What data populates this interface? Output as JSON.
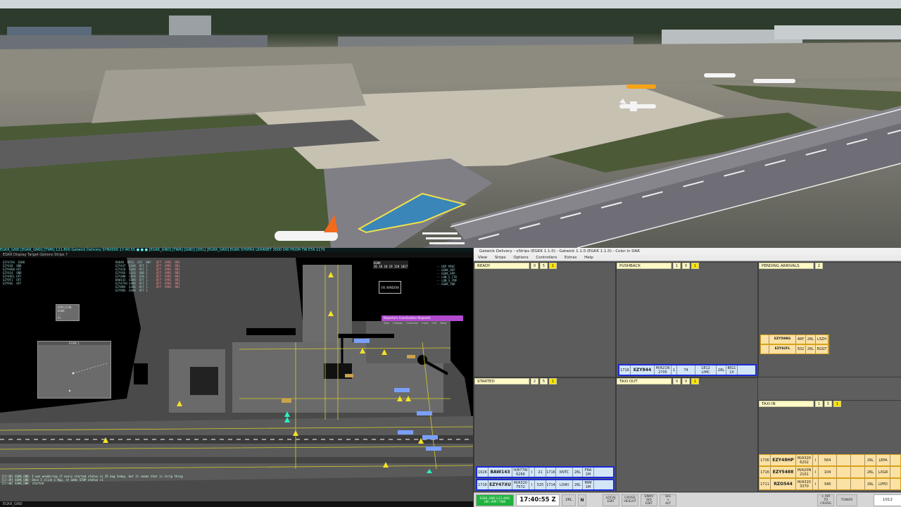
{
  "radar": {
    "topbar": "EGKK_GND  [EGKK_GND]  [TWR]   121.800   Gatwick Delivery   SYN0000   17:40:55   ● ● ●   [EGKK_GND]  [TWR]  [GND]  [DEL]  [EGKK_GND]  EGKK SYNTAX LEARNET 3000 ORI FROM TW ETA 1170",
    "menubar": "EGKK   Display   Target   Options   Strips   ?",
    "status_bar": "EGKK_GND",
    "list_a": "EZY47XA  EGKK\nEZY418  GND\nEZY94GW OFF\nEZY414  GND\nEZY492L OFF\nEZY9F1  OFF\nEZY9SG  OFF",
    "list_b": "RADAR  ORIG  DST  RWY\nEZY447  EGKK  OFF 1 \nEZY418  EGKK  OFF 1 \nEZY9SV  LSGG  GND 1 \nEZY4BH  LEPA  EGK 1 \nBAW143  EGKK  OFF 1 \nEZY47XU EGKK  OFF 1 \nEZY8RV  EGKK  OFF 1 \nEZY9QS  EGKK  OFF 1 ",
    "list_c": "QF7  APR1  RR1\nQF7  APR1  RR1\nQF7  APR1  RR1\nQF7  APR1  RR1\nQF7  APR1  RR1\nQF7  APR1  RR1\nQF7  APR1  RR1\nQF7  APR1  RR1",
    "list_log": "[17:38] EGKK_GND: I was wondering if every started status is 35 bug today, but it seems that is strip thing\n[17:39] EGKK_GND: Once I click 1 Hyp, it adds STUP status +1\n[17:40] EGKK_GND: started",
    "small_label": "APPLICAN\nEGKK\n--\nFL",
    "window_label": "EGKK 1",
    "dep_panel_title": "Departure Coordination Requests",
    "dep_panel_cols": "Type  Callsign  Controller  Input  CLR  Resp",
    "metar": "EGKK\n26 18 10 19 128 1017",
    "top_right_list": "-- DEP PROC\n-- EGKK_DEP\n-- EGKK_APP\n-- LON_S_CTR\n-- LON_S_FMP\n-- EGKK_TWR",
    "box_label": "VIS WINDOW"
  },
  "strips": {
    "title": "Gatwick Delivery - vStrips (EGKK 1.1.0) - Gatwick 1.1.0 (EGKK 1.1.0) - Color in DAR",
    "menu": [
      "View",
      "Strips",
      "Options",
      "Controllers",
      "Extras",
      "Help"
    ],
    "bays": {
      "ready": {
        "name": "READY",
        "c1": "0",
        "c2": "5",
        "c3": "1"
      },
      "pushback": {
        "name": "PUSHBACK",
        "c1": "1",
        "c2": "0",
        "c3": "1"
      },
      "pending": {
        "name": "PENDING ARRIVALS",
        "c1": "2"
      },
      "started": {
        "name": "STARTED",
        "c1": "2",
        "c2": "5",
        "c3": "1"
      },
      "taxiout": {
        "name": "TAXI OUT",
        "c1": "0",
        "c2": "0",
        "c3": "1"
      },
      "taxiin": {
        "name": "TAXI IN",
        "c1": "1",
        "c2": "5",
        "c3": "1"
      }
    },
    "pending_strips": [
      {
        "cs": "EZY59NG",
        "a": "4RF",
        "b": "26L",
        "c": "LSZH"
      },
      {
        "cs": "EZY82FL",
        "a": "502",
        "b": "26L",
        "c": "EGGT"
      }
    ],
    "pushback_strip": {
      "time": "1716",
      "cs": "EZY844",
      "type": "M/A21N",
      "sq": "2705",
      "flag": "1",
      "stand": "74",
      "rwy": "26L",
      "stand2": "1812",
      "dest": "LIMC",
      "sid": "BIG1",
      "sid2": "1X"
    },
    "started_strips": [
      {
        "time": "1626",
        "cs": "BAW143",
        "type": "H/B77W",
        "sq": "6266",
        "flag": "I",
        "stand": "21",
        "rwy": "26L",
        "t2": "1716",
        "dest": "KNTC",
        "sid": "FRA",
        "sid2": "1M"
      },
      {
        "time": "1716",
        "cs": "EZY47XU",
        "type": "M/A320",
        "sq": "7572",
        "flag": "I",
        "stand": "525",
        "rwy": "26L",
        "t2": "1714",
        "dest": "LOWI",
        "sid": "MIM",
        "sid2": "1M"
      }
    ],
    "taxiin_strips": [
      {
        "time": "1736",
        "cs": "EZY48HP",
        "type": "M/A320",
        "sq": "6202",
        "flag": "I",
        "stand": "564",
        "rwy": "26L",
        "dest": "LEPA"
      },
      {
        "time": "1716",
        "cs": "EZY5488",
        "type": "M/A20N",
        "sq": "2161",
        "flag": "I",
        "stand": "104",
        "rwy": "26L",
        "dest": "LXGR"
      },
      {
        "time": "1711",
        "cs": "RZO544",
        "type": "M/A320",
        "sq": "3370",
        "flag": "I",
        "stand": "34R",
        "rwy": "26L",
        "dest": "LPPD"
      }
    ],
    "bottom": {
      "green_btn": "EGKK_GND (121.800)\nON / APP / TWR",
      "clock": "17:40:55 Z",
      "rwy": "26L",
      "dir": "N",
      "local_edit": "LOCAL\nEDIT",
      "cross_height": "CROSS\nHEIGHT",
      "enhv": "ENHV\nSID\nEDIT",
      "sig": "SIG\n+\nALT",
      "ftarr": "+ AIR\nTO\nCROSS",
      "tower": "TOWER",
      "qnh": "1012"
    }
  }
}
